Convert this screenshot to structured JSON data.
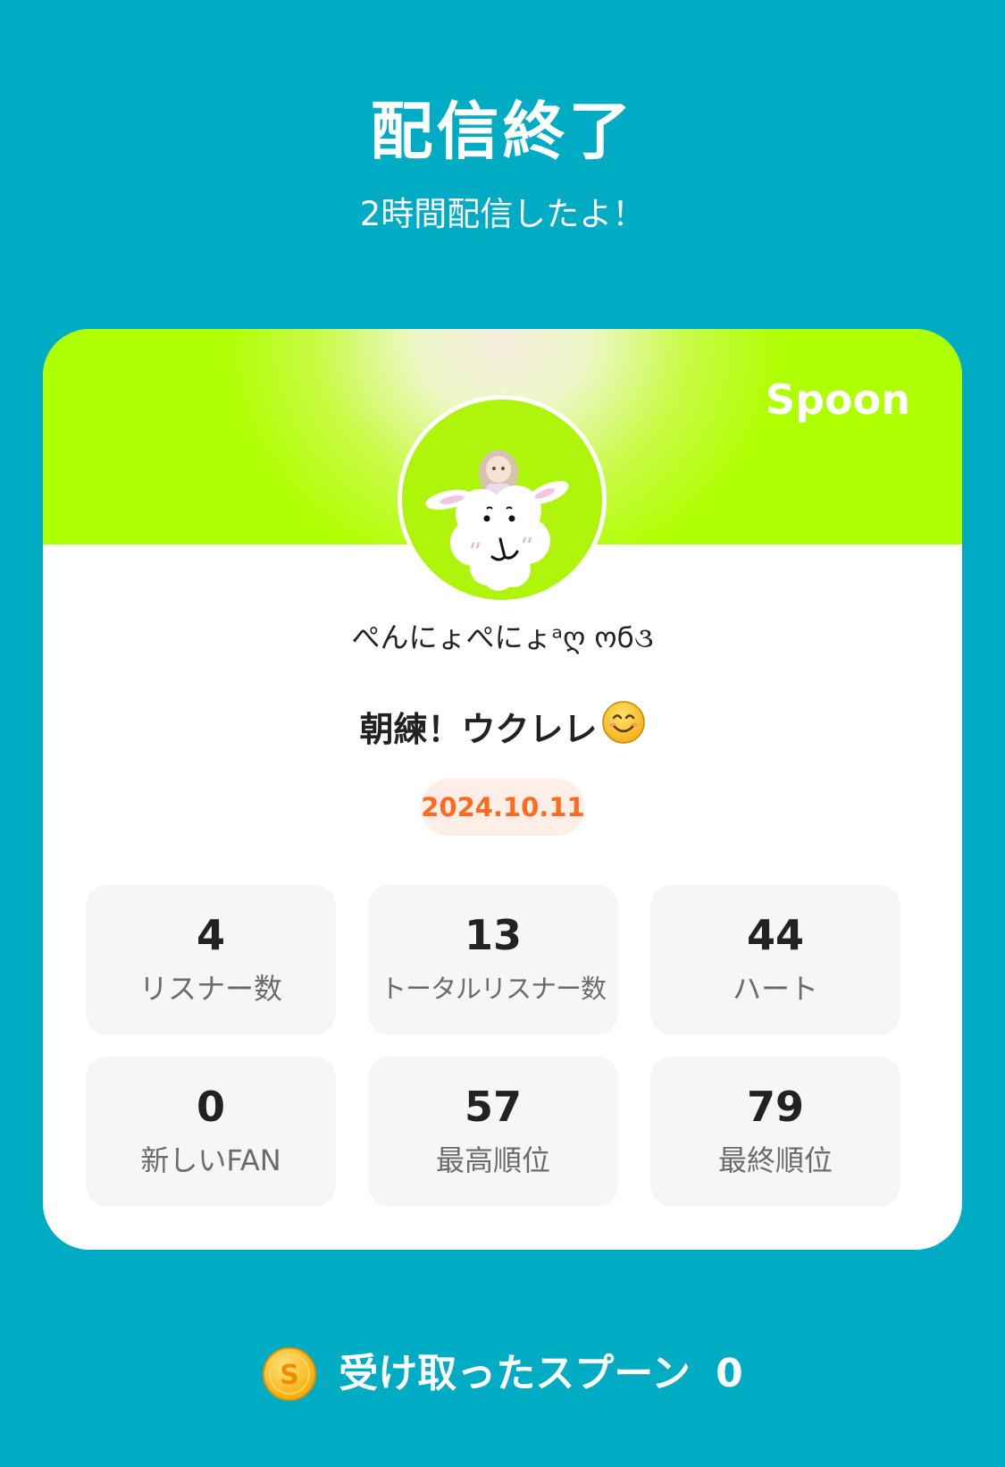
{
  "header": {
    "title": "配信終了",
    "subtitle": "2時間配信したよ！"
  },
  "card": {
    "brand": "Spoon",
    "username": "ぺんにょぺにょᵃღ ოϭ૩",
    "stream_title": "朝練！ウクレレ",
    "title_emoji": "smiling-face-icon",
    "date": "2024.10.11",
    "stats": [
      {
        "value": "4",
        "label": "リスナー数"
      },
      {
        "value": "13",
        "label": "トータルリスナー数"
      },
      {
        "value": "44",
        "label": "ハート"
      },
      {
        "value": "0",
        "label": "新しいFAN"
      },
      {
        "value": "57",
        "label": "最高順位"
      },
      {
        "value": "79",
        "label": "最終順位"
      }
    ]
  },
  "footer": {
    "icon": "spoon-coin-icon",
    "label": "受け取ったスプーン",
    "count": "0"
  },
  "colors": {
    "background": "#00abc4",
    "banner": "#aeff00",
    "date_text": "#ff6a1f",
    "date_bg": "#fdeee8"
  }
}
